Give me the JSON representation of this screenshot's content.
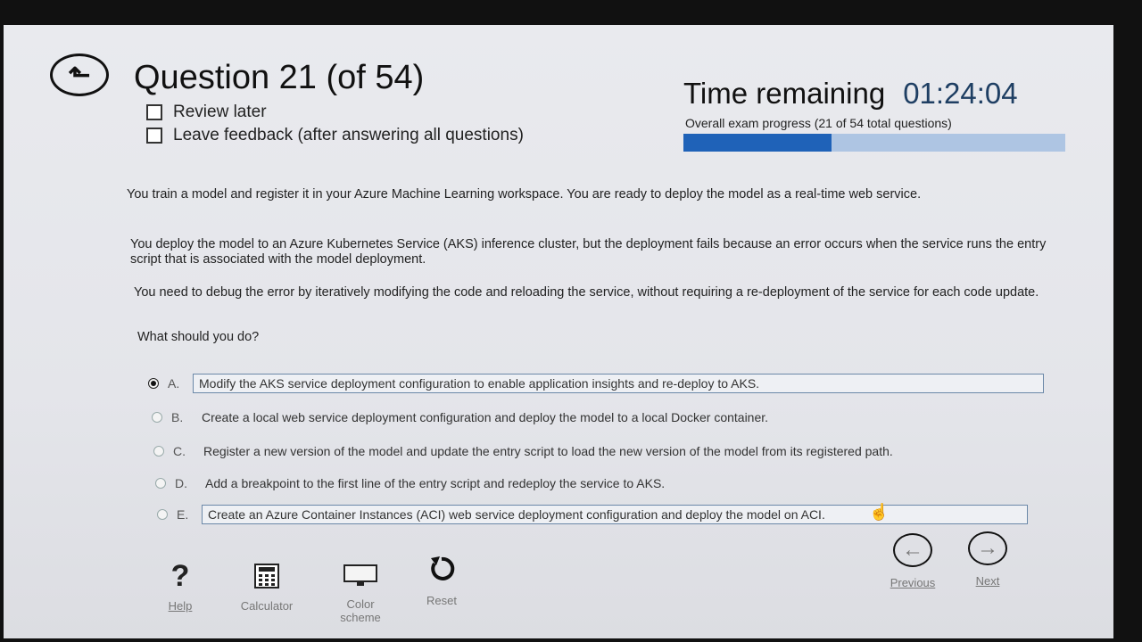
{
  "header": {
    "question_title": "Question 21 (of 54)",
    "review_later": "Review later",
    "leave_feedback": "Leave feedback (after answering all questions)",
    "time_label": "Time remaining",
    "time_value": "01:24:04",
    "progress_label": "Overall exam progress (21 of 54 total questions)",
    "progress_fraction": 0.389
  },
  "question": {
    "paragraph1": "You train a model and register it in your Azure Machine Learning workspace. You are ready to deploy the model as a real-time web service.",
    "paragraph2": "You deploy the model to an Azure Kubernetes Service (AKS) inference cluster, but the deployment fails because an error occurs when the service runs the entry script that is associated with the model deployment.",
    "paragraph3": "You need to debug the error by iteratively modifying the code and reloading the service, without requiring a re-deployment of the service for each code update.",
    "prompt": "What should you do?"
  },
  "options": [
    {
      "letter": "A.",
      "text": "Modify the AKS service deployment configuration to enable application insights and re-deploy to AKS.",
      "selected": true
    },
    {
      "letter": "B.",
      "text": "Create a local web service deployment configuration and deploy the model to a local Docker container.",
      "selected": false
    },
    {
      "letter": "C.",
      "text": "Register a new version of the model and update the entry script to load the new version of the model from its registered path.",
      "selected": false
    },
    {
      "letter": "D.",
      "text": "Add a breakpoint to the first line of the entry script and redeploy the service to AKS.",
      "selected": false
    },
    {
      "letter": "E.",
      "text": "Create an Azure Container Instances (ACI) web service deployment configuration and deploy the model on ACI.",
      "selected": false
    }
  ],
  "toolbar": {
    "help": "Help",
    "calculator": "Calculator",
    "color_scheme_line1": "Color",
    "color_scheme_line2": "scheme",
    "reset": "Reset",
    "previous": "Previous",
    "next": "Next"
  },
  "icons": {
    "back": "back-arrow-icon",
    "help": "question-mark-icon",
    "calculator": "calculator-icon",
    "color_scheme": "monitor-icon",
    "reset": "reset-arrow-icon",
    "previous": "left-arrow-icon",
    "next": "right-arrow-icon"
  },
  "colors": {
    "progress_fill": "#1f62b8",
    "progress_track": "#aec5e3",
    "time_value": "#1f3f63"
  }
}
